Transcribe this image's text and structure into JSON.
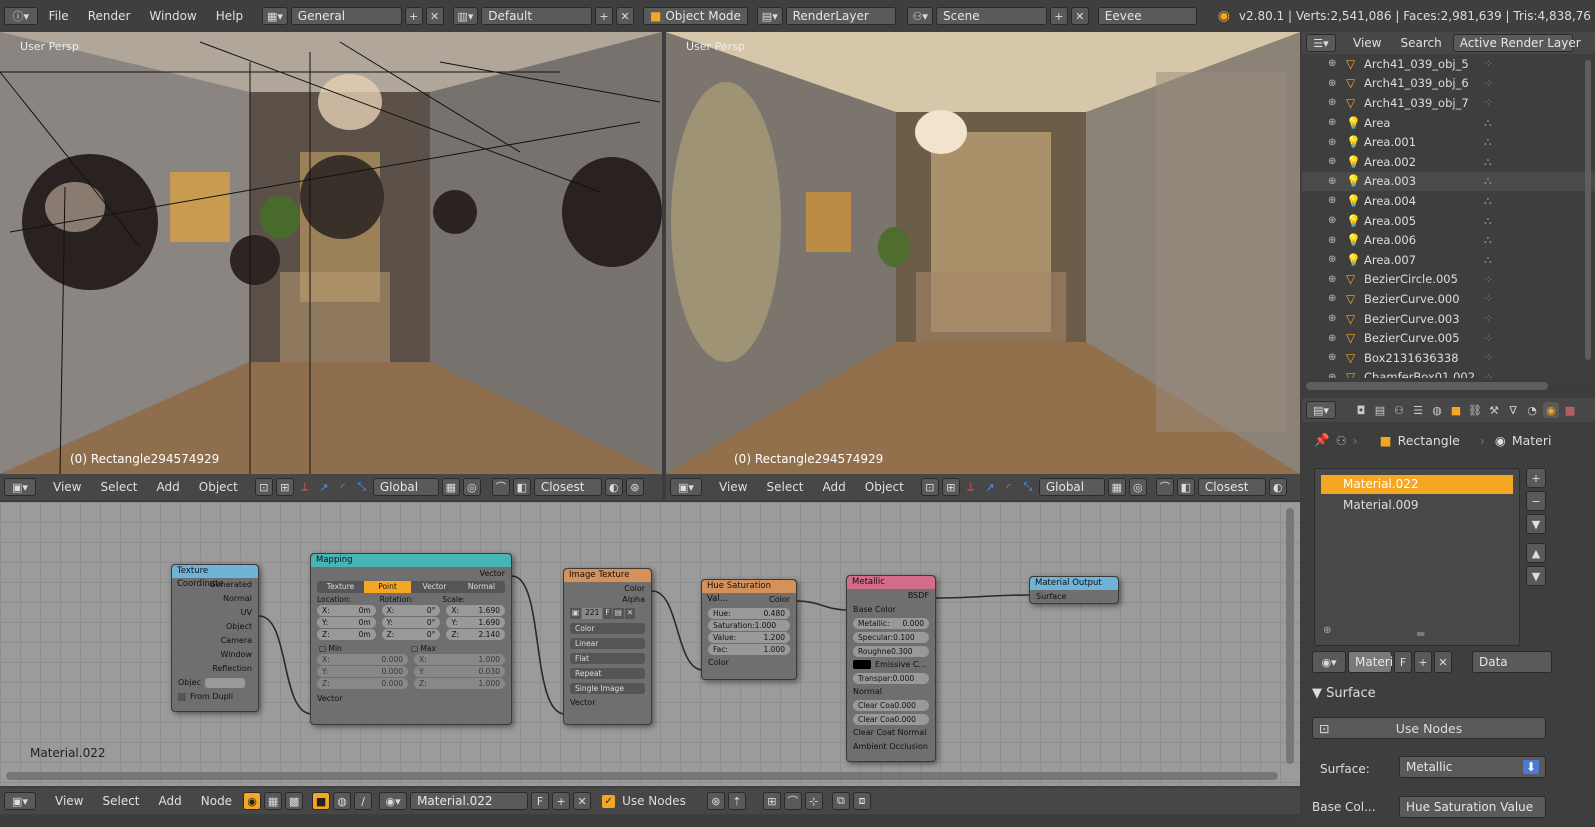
{
  "topbar": {
    "menus": [
      "File",
      "Render",
      "Window",
      "Help"
    ],
    "layout": "General",
    "screen": "Default",
    "mode": "Object Mode",
    "render_layer": "RenderLayer",
    "scene": "Scene",
    "engine": "Eevee",
    "stats": "v2.80.1 | Verts:2,541,086 | Faces:2,981,639 | Tris:4,838,76"
  },
  "viewport_left": {
    "label": "User Persp",
    "object": "(0) Rectangle294574929",
    "menus": [
      "View",
      "Select",
      "Add",
      "Object"
    ],
    "orientation": "Global",
    "snap": "Closest"
  },
  "viewport_right": {
    "label": "User Persp",
    "object": "(0) Rectangle294574929",
    "menus": [
      "View",
      "Select",
      "Add",
      "Object"
    ],
    "orientation": "Global",
    "snap": "Closest"
  },
  "outliner": {
    "tabs": [
      "View",
      "Search",
      "Active Render Layer"
    ],
    "items": [
      {
        "name": "Arch41_039_obj_5",
        "type": "mesh"
      },
      {
        "name": "Arch41_039_obj_6",
        "type": "mesh"
      },
      {
        "name": "Arch41_039_obj_7",
        "type": "mesh"
      },
      {
        "name": "Area",
        "type": "light"
      },
      {
        "name": "Area.001",
        "type": "light"
      },
      {
        "name": "Area.002",
        "type": "light"
      },
      {
        "name": "Area.003",
        "type": "light"
      },
      {
        "name": "Area.004",
        "type": "light"
      },
      {
        "name": "Area.005",
        "type": "light"
      },
      {
        "name": "Area.006",
        "type": "light"
      },
      {
        "name": "Area.007",
        "type": "light"
      },
      {
        "name": "BezierCircle.005",
        "type": "mesh"
      },
      {
        "name": "BezierCurve.000",
        "type": "mesh"
      },
      {
        "name": "BezierCurve.003",
        "type": "mesh"
      },
      {
        "name": "BezierCurve.005",
        "type": "mesh"
      },
      {
        "name": "Box2131636338",
        "type": "mesh"
      },
      {
        "name": "ChamferBox01.002",
        "type": "mesh"
      }
    ]
  },
  "properties": {
    "breadcrumb_object": "Rectangle",
    "breadcrumb_material": "Materi",
    "slots": [
      "Material.022",
      "Material.009"
    ],
    "mat_name": "Materi",
    "mat_f": "F",
    "data_select": "Data",
    "surface_header": "Surface",
    "use_nodes": "Use Nodes",
    "surface_label": "Surface:",
    "surface_value": "Metallic",
    "base_color_label": "Base Col...",
    "base_color_value": "Hue Saturation Value"
  },
  "node_editor": {
    "material_label": "Material.022",
    "menus": [
      "View",
      "Select",
      "Add",
      "Node"
    ],
    "material": "Material.022",
    "mat_f": "F",
    "use_nodes": "Use Nodes"
  },
  "nodes": {
    "texcoord": {
      "title": "Texture Coordinate",
      "outputs": [
        "Generated",
        "Normal",
        "UV",
        "Object",
        "Camera",
        "Window",
        "Reflection"
      ],
      "object_label": "Objec",
      "from_dupli": "From Dupli"
    },
    "mapping": {
      "title": "Mapping",
      "out": "Vector",
      "tabs": [
        "Texture",
        "Point",
        "Vector",
        "Normal"
      ],
      "loc": "Location:",
      "rot": "Rotation:",
      "scale": "Scale:",
      "x": "X:",
      "y": "Y:",
      "z": "Z:",
      "lx": "0m",
      "ly": "0m",
      "lz": "0m",
      "rx": "0°",
      "ry": "0°",
      "rz": "0°",
      "sx": "1.690",
      "sy": "1.690",
      "sz": "2.140",
      "min": "Min",
      "max": "Max",
      "minv": "0.000",
      "maxx": "1.000",
      "maxy": "0.030",
      "maxz": "1.000",
      "in": "Vector"
    },
    "image": {
      "title": "Image Texture",
      "outs": [
        "Color",
        "Alpha"
      ],
      "num": "221",
      "f": "F",
      "opts": [
        "Color",
        "Linear",
        "Flat",
        "Repeat",
        "Single Image"
      ],
      "in": "Vector"
    },
    "hsv": {
      "title": "Hue Saturation Val...",
      "out": "Color",
      "hue_l": "Hue:",
      "hue": "0.480",
      "sat": "Saturation:1.000",
      "val_l": "Value:",
      "val": "1.200",
      "fac_l": "Fac:",
      "fac": "1.000",
      "in": "Color"
    },
    "metallic": {
      "title": "Metallic",
      "out": "BSDF",
      "base": "Base Color",
      "metal_l": "Metallic:",
      "metal": "0.000",
      "spec": "Specular:0.100",
      "rough": "Roughne0.300",
      "emis": "Emissive C...",
      "transp": "Transpar:0.000",
      "normal": "Normal",
      "cc1": "Clear Coa0.000",
      "cc2": "Clear Coa0.000",
      "ccn": "Clear Coat Normal",
      "ao": "Ambient Occlusion"
    },
    "output": {
      "title": "Material Output",
      "in": "Surface"
    }
  },
  "colors": {
    "accent": "#f5a623",
    "texcoord_head": "#6fb4d8",
    "mapping_head": "#47b5b5",
    "image_head": "#d4915a",
    "hsv_head": "#d4915a",
    "metallic_head": "#d46d8a",
    "output_head": "#6fb4d8"
  }
}
